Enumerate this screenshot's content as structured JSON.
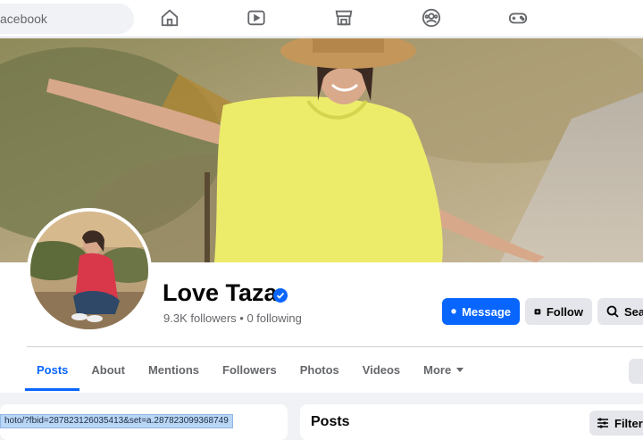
{
  "search": {
    "text": "acebook"
  },
  "nav": {
    "icons": [
      "home-icon",
      "video-icon",
      "marketplace-icon",
      "groups-icon",
      "gaming-icon"
    ]
  },
  "profile": {
    "name": "Love Taza",
    "verified": true,
    "followers": "9.3K followers",
    "separator": "•",
    "following": "0 following"
  },
  "actions": {
    "message": "Message",
    "follow": "Follow",
    "search": "Sear"
  },
  "tabs": [
    "Posts",
    "About",
    "Mentions",
    "Followers",
    "Photos",
    "Videos",
    "More"
  ],
  "active_tab": "Posts",
  "feed": {
    "posts_title": "Posts",
    "filters": "Filters"
  },
  "status_bar": {
    "url": "hoto/?fbid=287823126035413&set=a.287823099368749"
  },
  "colors": {
    "accent": "#0866ff",
    "button_gray": "#e4e6eb",
    "text_secondary": "#65676b"
  }
}
